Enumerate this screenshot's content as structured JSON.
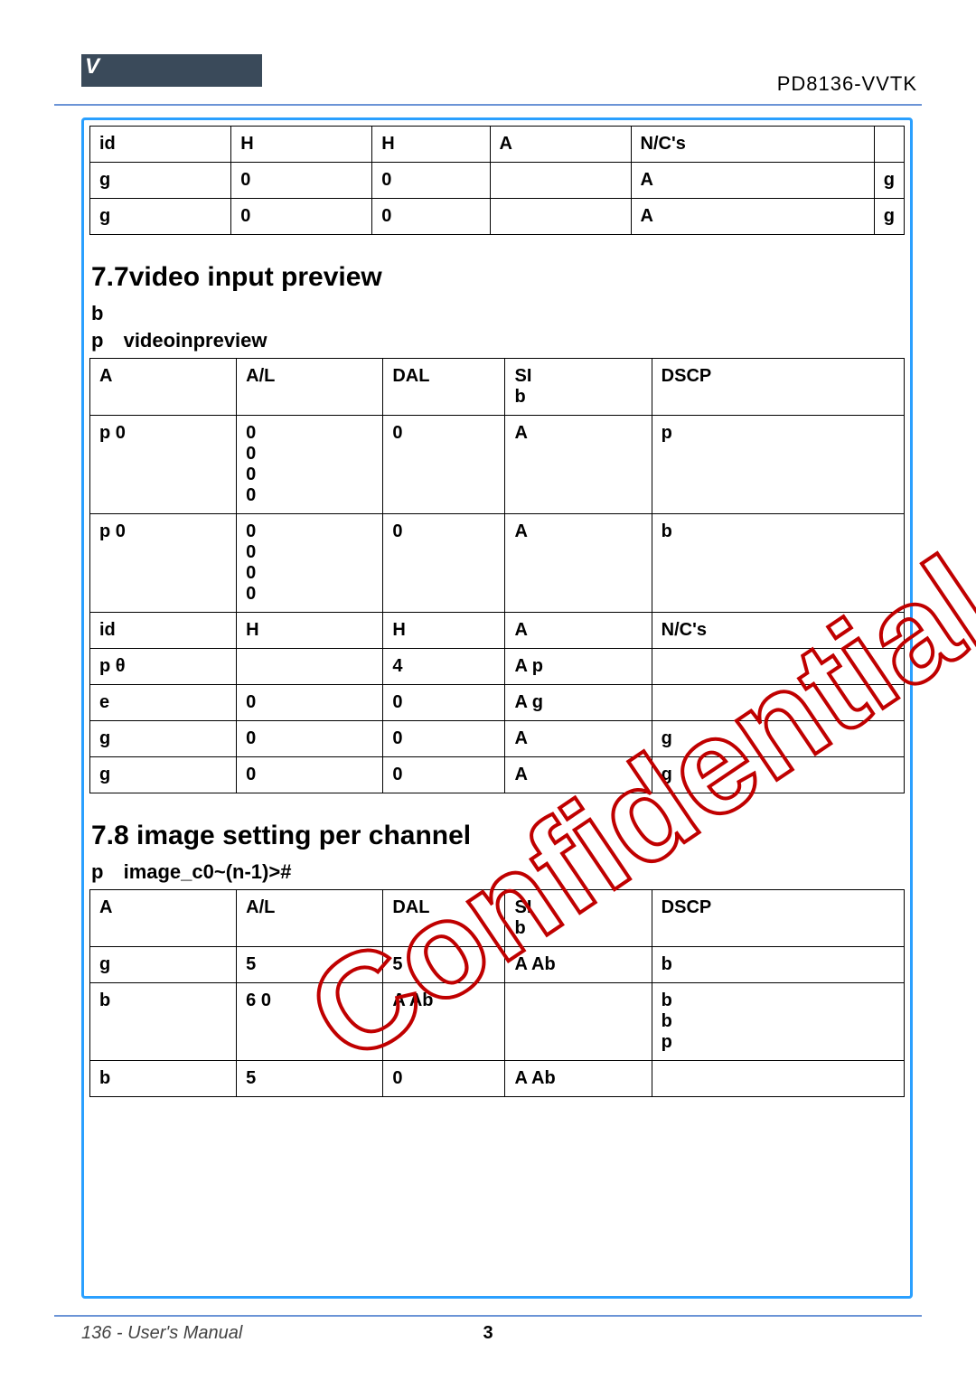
{
  "header": {
    "brand_char": "V",
    "model": "PD8136-VVTK"
  },
  "top_table": {
    "rows": [
      [
        "id",
        "H",
        "H",
        "A",
        "N/C's",
        ""
      ],
      [
        "g",
        "0",
        "0",
        "",
        "A",
        "g"
      ],
      [
        "g",
        "0",
        "0",
        "",
        "A",
        "g"
      ]
    ]
  },
  "section77": {
    "title": "7.7video input preview",
    "sub": "b",
    "group_prefix": "p",
    "group_name": "videoinpreview",
    "table": {
      "header": [
        "A",
        "A/L",
        "DAL",
        "SI\nb",
        "DSCP"
      ],
      "rows": [
        [
          "p       0",
          "0\n0\n0\n0",
          "0",
          "A",
          "p"
        ],
        [
          "p       0",
          "0\n0\n0\n0",
          "0",
          "A",
          "b"
        ],
        [
          "id",
          "H",
          "H",
          "A",
          "N/C's"
        ],
        [
          "p     θ",
          "",
          "4",
          "A        p",
          ""
        ],
        [
          "e",
          "0",
          "0",
          "A        g",
          ""
        ],
        [
          "g",
          "0",
          "0",
          "A",
          "g"
        ],
        [
          "g",
          "0",
          "0",
          "A",
          "g"
        ]
      ]
    }
  },
  "section78": {
    "title": "7.8 image setting per channel",
    "group_prefix": "p",
    "group_name": "image_c0~(n-1)>#",
    "table": {
      "header": [
        "A",
        "A/L",
        "DAL",
        "SI\nb",
        "DSCP"
      ],
      "rows": [
        [
          "g",
          "5",
          "5",
          "A         Ab",
          "b"
        ],
        [
          "b",
          "6       0",
          "A         Ab",
          "",
          "b\nb\np"
        ],
        [
          "b",
          "5",
          "0",
          "A         Ab",
          ""
        ]
      ]
    }
  },
  "footer": {
    "page_text": "136 - User's Manual",
    "center": "3"
  }
}
